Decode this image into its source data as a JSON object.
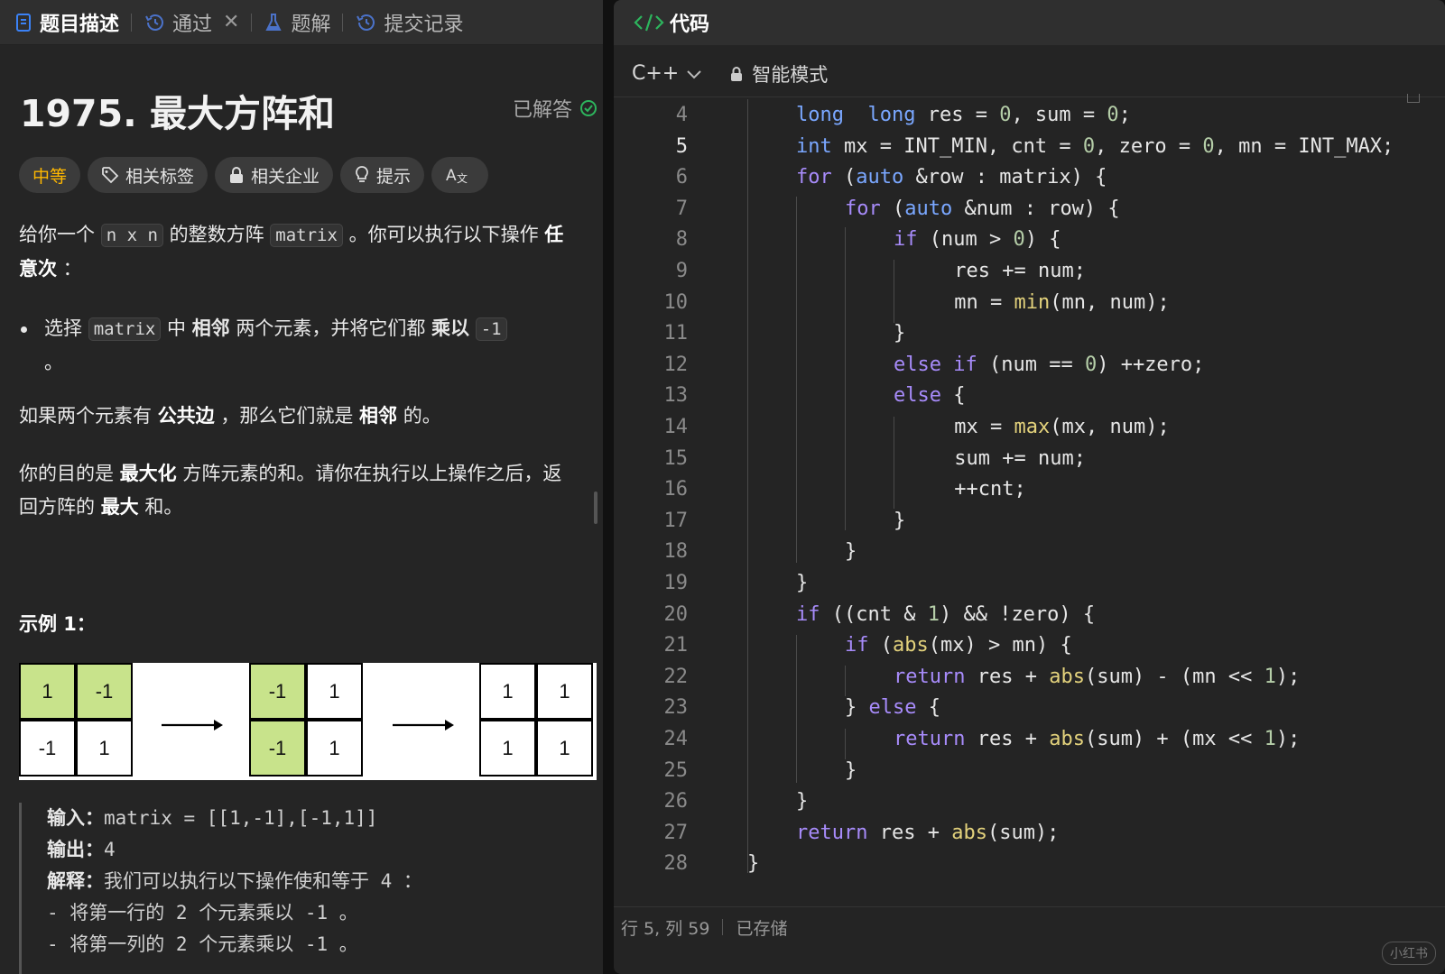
{
  "tabs": {
    "description": "题目描述",
    "passed": "通过",
    "solution": "题解",
    "submissions": "提交记录"
  },
  "problem": {
    "title": "1975. 最大方阵和",
    "solved": "已解答",
    "chips": {
      "difficulty": "中等",
      "tags": "相关标签",
      "companies": "相关企业",
      "hint": "提示"
    },
    "desc1": [
      "给你一个 ",
      "n x n",
      " 的整数方阵 ",
      "matrix",
      " 。你可以执行以下操作 ",
      "任意次",
      " ："
    ],
    "bullet": [
      "选择 ",
      "matrix",
      " 中 ",
      "相邻",
      " 两个元素，并将它们都 ",
      "乘以",
      " ",
      "-1",
      " 。"
    ],
    "desc2": [
      "如果两个元素有 ",
      "公共边",
      " ，那么它们就是 ",
      "相邻",
      " 的。"
    ],
    "desc3": [
      "你的目的是 ",
      "最大化",
      " 方阵元素的和。请你在执行以上操作之后，返回方阵的 ",
      "最大",
      " 和。"
    ],
    "example_title": "示例 1：",
    "grid1": [
      "1",
      "-1",
      "-1",
      "1"
    ],
    "grid2": [
      "-1",
      "1",
      "-1",
      "1"
    ],
    "grid3": [
      "1",
      "1",
      "1",
      "1"
    ],
    "io": {
      "input_k": "输入：",
      "input_v": "matrix = [[1,-1],[-1,1]]",
      "output_k": "输出：",
      "output_v": "4",
      "explain_k": "解释：",
      "explain_v": "我们可以执行以下操作使和等于 4 ：",
      "step1": "- 将第一行的 2 个元素乘以 -1 。",
      "step2": "- 将第一列的 2 个元素乘以 -1 。"
    }
  },
  "editor": {
    "header": "代码",
    "language": "C++",
    "mode": "智能模式",
    "lines": [
      {
        "n": "4",
        "code": [
          [
            "kb",
            "long"
          ],
          [
            "",
            "  "
          ],
          [
            "kb",
            "long"
          ],
          [
            "",
            " res = "
          ],
          [
            "num",
            "0"
          ],
          [
            "",
            ", sum = "
          ],
          [
            "num",
            "0"
          ],
          [
            "",
            ";"
          ]
        ]
      },
      {
        "n": "5",
        "code": [
          [
            "kb",
            "int"
          ],
          [
            "",
            " mx = INT_MIN, cnt = "
          ],
          [
            "num",
            "0"
          ],
          [
            "",
            ", zero = "
          ],
          [
            "num",
            "0"
          ],
          [
            "",
            ", mn = INT_MAX;"
          ]
        ]
      },
      {
        "n": "6",
        "code": [
          [
            "kw",
            "for"
          ],
          [
            "",
            " ("
          ],
          [
            "kb",
            "auto"
          ],
          [
            "",
            " &row : matrix) {"
          ]
        ]
      },
      {
        "n": "7",
        "code": [
          [
            "kw",
            "for"
          ],
          [
            "",
            " ("
          ],
          [
            "kb",
            "auto"
          ],
          [
            "",
            " &num : row) {"
          ]
        ]
      },
      {
        "n": "8",
        "code": [
          [
            "kw",
            "if"
          ],
          [
            "",
            " (num > "
          ],
          [
            "num",
            "0"
          ],
          [
            "",
            ") {"
          ]
        ]
      },
      {
        "n": "9",
        "code": [
          [
            "",
            " res += num;"
          ]
        ]
      },
      {
        "n": "10",
        "code": [
          [
            "",
            " mn = "
          ],
          [
            "fn",
            "min"
          ],
          [
            "",
            "(mn, num);"
          ]
        ]
      },
      {
        "n": "11",
        "code": [
          [
            "",
            "}"
          ]
        ]
      },
      {
        "n": "12",
        "code": [
          [
            "kw",
            "else"
          ],
          [
            "",
            " "
          ],
          [
            "kw",
            "if"
          ],
          [
            "",
            " (num == "
          ],
          [
            "num",
            "0"
          ],
          [
            "",
            ") ++zero;"
          ]
        ]
      },
      {
        "n": "13",
        "code": [
          [
            "kw",
            "else"
          ],
          [
            "",
            " {"
          ]
        ]
      },
      {
        "n": "14",
        "code": [
          [
            "",
            " mx = "
          ],
          [
            "fn",
            "max"
          ],
          [
            "",
            "(mx, num);"
          ]
        ]
      },
      {
        "n": "15",
        "code": [
          [
            "",
            " sum += num;"
          ]
        ]
      },
      {
        "n": "16",
        "code": [
          [
            "",
            " ++cnt;"
          ]
        ]
      },
      {
        "n": "17",
        "code": [
          [
            "",
            "}"
          ]
        ]
      },
      {
        "n": "18",
        "code": [
          [
            "",
            "}"
          ]
        ]
      },
      {
        "n": "19",
        "code": [
          [
            "",
            "}"
          ]
        ]
      },
      {
        "n": "20",
        "code": [
          [
            "kw",
            "if"
          ],
          [
            "",
            " ((cnt & "
          ],
          [
            "num",
            "1"
          ],
          [
            "",
            ") && !zero) {"
          ]
        ]
      },
      {
        "n": "21",
        "code": [
          [
            "kw",
            "if"
          ],
          [
            "",
            " ("
          ],
          [
            "fn",
            "abs"
          ],
          [
            "",
            "(mx) > mn) {"
          ]
        ]
      },
      {
        "n": "22",
        "code": [
          [
            "kw",
            "return"
          ],
          [
            "",
            " res + "
          ],
          [
            "fn",
            "abs"
          ],
          [
            "",
            "(sum) - (mn << "
          ],
          [
            "num",
            "1"
          ],
          [
            "",
            ");"
          ]
        ]
      },
      {
        "n": "23",
        "code": [
          [
            "",
            "} "
          ],
          [
            "kw",
            "else"
          ],
          [
            "",
            " {"
          ]
        ]
      },
      {
        "n": "24",
        "code": [
          [
            "kw",
            "return"
          ],
          [
            "",
            " res + "
          ],
          [
            "fn",
            "abs"
          ],
          [
            "",
            "(sum) + (mx << "
          ],
          [
            "num",
            "1"
          ],
          [
            "",
            ");"
          ]
        ]
      },
      {
        "n": "25",
        "code": [
          [
            "",
            "}"
          ]
        ]
      },
      {
        "n": "26",
        "code": [
          [
            "",
            "}"
          ]
        ]
      },
      {
        "n": "27",
        "code": [
          [
            "kw",
            "return"
          ],
          [
            "",
            " res + "
          ],
          [
            "fn",
            "abs"
          ],
          [
            "",
            "(sum);"
          ]
        ]
      },
      {
        "n": "28",
        "code": [
          [
            "",
            "}"
          ]
        ]
      }
    ],
    "current_line": "5",
    "status_pos": "行 5, 列 59",
    "status_saved": "已存储"
  },
  "watermark": "小红书"
}
